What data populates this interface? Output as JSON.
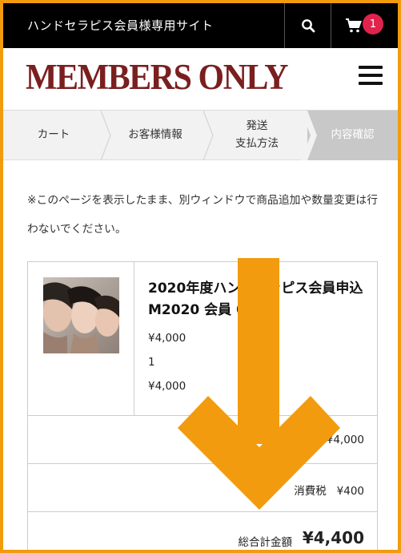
{
  "header": {
    "site_name": "ハンドセラピス会員様専用サイト",
    "cart_count": "1",
    "search_icon": "search-icon",
    "cart_icon": "cart-icon"
  },
  "logo": {
    "text": "MEMBERS ONLY"
  },
  "steps": [
    {
      "label": "カート"
    },
    {
      "label": "お客様情報"
    },
    {
      "label_line1": "発送",
      "label_line2": "支払方法"
    },
    {
      "label": "内容確認"
    }
  ],
  "notice": "※このページを表示したまま、別ウィンドウで商品追加や数量変更は行わないでください。",
  "cart": {
    "item": {
      "name": "2020年度ハンドセラピス会員申込 M2020 会員 001",
      "price": "¥4,000",
      "quantity": "1",
      "line_total": "¥4,000"
    },
    "subtotal_value": "¥4,000",
    "tax_label": "消費税",
    "tax_value": "¥400",
    "total_label": "総合計金額",
    "total_value": "¥4,400"
  },
  "colors": {
    "frame": "#f29b0e",
    "arrow": "#f29b0e",
    "logo": "#7a1f1f",
    "badge": "#e0234d"
  }
}
